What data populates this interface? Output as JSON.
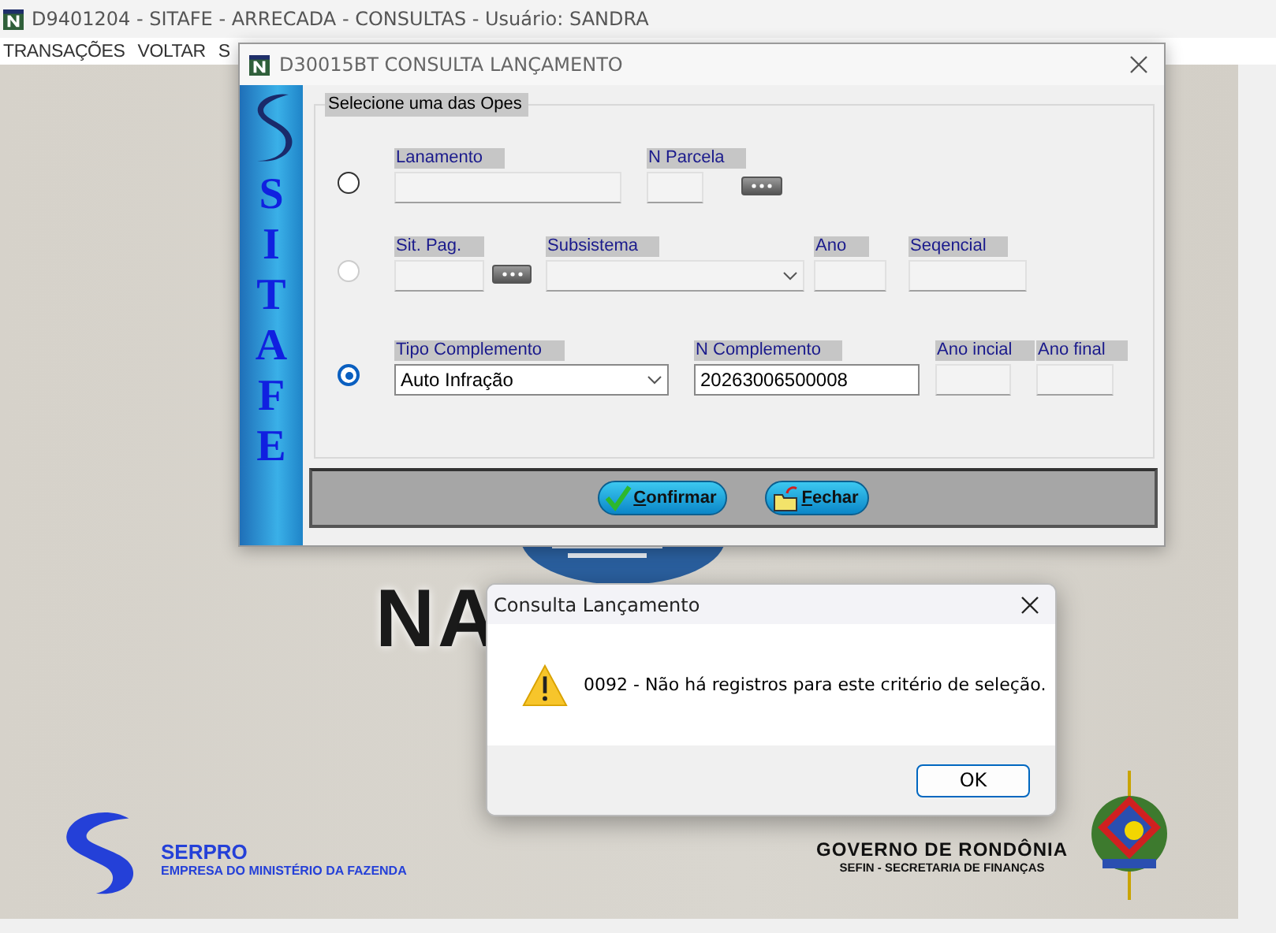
{
  "window": {
    "title": "D9401204 - SITAFE - ARRECADA - CONSULTAS - Usuário: SANDRA"
  },
  "menu": [
    "TRANSAÇÕES",
    "VOLTAR",
    "S"
  ],
  "background": {
    "logo_text": "NA"
  },
  "footer": {
    "left_title": "SERPRO",
    "left_subtitle": "EMPRESA DO MINISTÉRIO DA FAZENDA",
    "right_title": "GOVERNO DE RONDÔNIA",
    "right_subtitle": "SEFIN - SECRETARIA DE FINANÇAS"
  },
  "query_window": {
    "title": "D30015BT CONSULTA LANÇAMENTO",
    "brand": "SITAFE",
    "group_label": "Selecione uma das Opes",
    "options": [
      {
        "selected": false,
        "disabled": false,
        "fields": [
          {
            "kind": "text",
            "label": "Lanamento",
            "disabled": true
          },
          {
            "kind": "text",
            "label": "N Parcela",
            "disabled": true
          },
          {
            "kind": "lookup"
          }
        ]
      },
      {
        "selected": false,
        "disabled": true,
        "fields": [
          {
            "kind": "text",
            "label": "Sit. Pag.",
            "disabled": true
          },
          {
            "kind": "lookup"
          },
          {
            "kind": "select",
            "label": "Subsistema",
            "disabled": true
          },
          {
            "kind": "text",
            "label": "Ano",
            "disabled": true
          },
          {
            "kind": "text",
            "label": "Seqencial",
            "disabled": true
          }
        ]
      },
      {
        "selected": true,
        "disabled": false,
        "fields": [
          {
            "kind": "select",
            "label": "Tipo Complemento",
            "value": "Auto Infração",
            "disabled": false
          },
          {
            "kind": "text",
            "label": "N Complemento",
            "value": "20263006500008",
            "disabled": false
          },
          {
            "kind": "text",
            "label": "Ano incial",
            "disabled": true
          },
          {
            "kind": "text",
            "label": "Ano final",
            "disabled": true
          }
        ]
      }
    ],
    "buttons": [
      {
        "kind": "confirm",
        "label": "Confirmar"
      },
      {
        "kind": "close",
        "label": "Fechar"
      }
    ]
  },
  "message_dialog": {
    "title": "Consulta Lançamento",
    "message": "0092 - Não há registros para este critério de seleção.",
    "button": "OK"
  }
}
